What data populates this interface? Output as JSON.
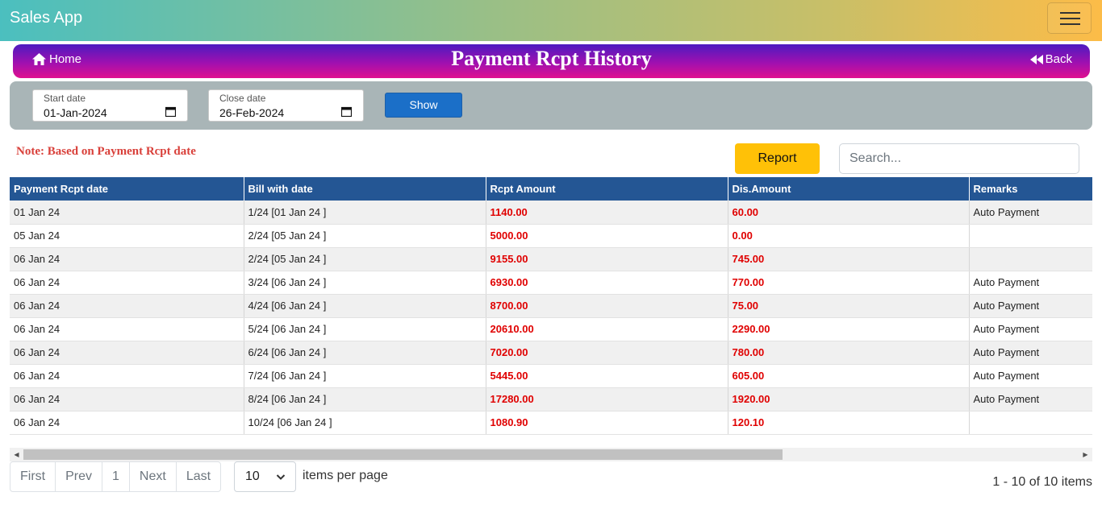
{
  "navbar": {
    "brand": "Sales App",
    "menu_icon": "hamburger-icon"
  },
  "titlebar": {
    "home": "Home",
    "title": "Payment Rcpt History",
    "back": "Back"
  },
  "filters": {
    "start_label": "Start date",
    "start_value": "01-Jan-2024",
    "close_label": "Close date",
    "close_value": "26-Feb-2024",
    "show": "Show"
  },
  "note": "Note: Based on Payment Rcpt date",
  "report": "Report",
  "search": {
    "placeholder": "Search..."
  },
  "table": {
    "columns": [
      "Payment Rcpt date",
      "Bill with date",
      "Rcpt Amount",
      "Dis.Amount",
      "Remarks"
    ],
    "rows": [
      [
        "01 Jan 24",
        "1/24 [01 Jan 24 ]",
        "1140.00",
        "60.00",
        "Auto Payment"
      ],
      [
        "05 Jan 24",
        "2/24 [05 Jan 24 ]",
        "5000.00",
        "0.00",
        ""
      ],
      [
        "06 Jan 24",
        "2/24 [05 Jan 24 ]",
        "9155.00",
        "745.00",
        ""
      ],
      [
        "06 Jan 24",
        "3/24 [06 Jan 24 ]",
        "6930.00",
        "770.00",
        "Auto Payment"
      ],
      [
        "06 Jan 24",
        "4/24 [06 Jan 24 ]",
        "8700.00",
        "75.00",
        "Auto Payment"
      ],
      [
        "06 Jan 24",
        "5/24 [06 Jan 24 ]",
        "20610.00",
        "2290.00",
        "Auto Payment"
      ],
      [
        "06 Jan 24",
        "6/24 [06 Jan 24 ]",
        "7020.00",
        "780.00",
        "Auto Payment"
      ],
      [
        "06 Jan 24",
        "7/24 [06 Jan 24 ]",
        "5445.00",
        "605.00",
        "Auto Payment"
      ],
      [
        "06 Jan 24",
        "8/24 [06 Jan 24 ]",
        "17280.00",
        "1920.00",
        "Auto Payment"
      ],
      [
        "06 Jan 24",
        "10/24 [06 Jan 24 ]",
        "1080.90",
        "120.10",
        ""
      ]
    ]
  },
  "pager": {
    "first": "First",
    "prev": "Prev",
    "page": "1",
    "next": "Next",
    "last": "Last"
  },
  "page_size": "10",
  "items_per_page": "items per page",
  "range": "1 - 10 of 10 items",
  "colors": {
    "header_bg": "#245694",
    "amount_text": "#e00000",
    "report_bg": "#ffc107",
    "show_bg": "#1b6fc8"
  }
}
